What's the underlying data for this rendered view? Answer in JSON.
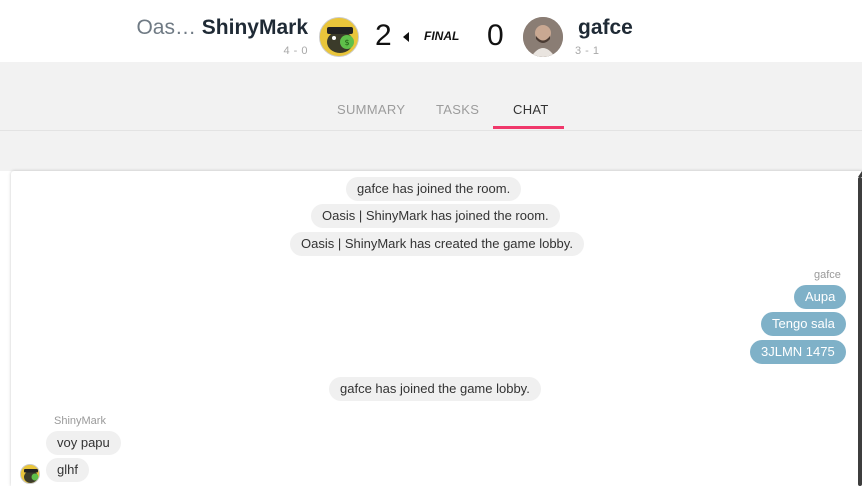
{
  "match": {
    "left_team": {
      "tag": "Oas…",
      "name": "ShinyMark",
      "record": "4 - 0",
      "score": "2",
      "avatar_icon": "cartoon-avatar-icon"
    },
    "status": "FINAL",
    "right_team": {
      "name": "gafce",
      "record": "3 - 1",
      "score": "0",
      "avatar_icon": "player-photo-avatar-icon"
    }
  },
  "tabs": {
    "summary": "SUMMARY",
    "tasks": "TASKS",
    "chat": "CHAT",
    "active": "chat",
    "accent_color": "#f0386b"
  },
  "chat": {
    "system_messages": [
      "gafce has joined the room.",
      "Oasis | ShinyMark has joined the room.",
      "Oasis | ShinyMark has created the game lobby.",
      "gafce has joined the game lobby."
    ],
    "outgoing": {
      "sender": "gafce",
      "messages": [
        "Aupa",
        "Tengo sala",
        "3JLMN 1475"
      ],
      "bubble_color": "#7fb1c8"
    },
    "incoming": {
      "sender": "ShinyMark",
      "messages": [
        "voy papu",
        "glhf"
      ]
    }
  }
}
